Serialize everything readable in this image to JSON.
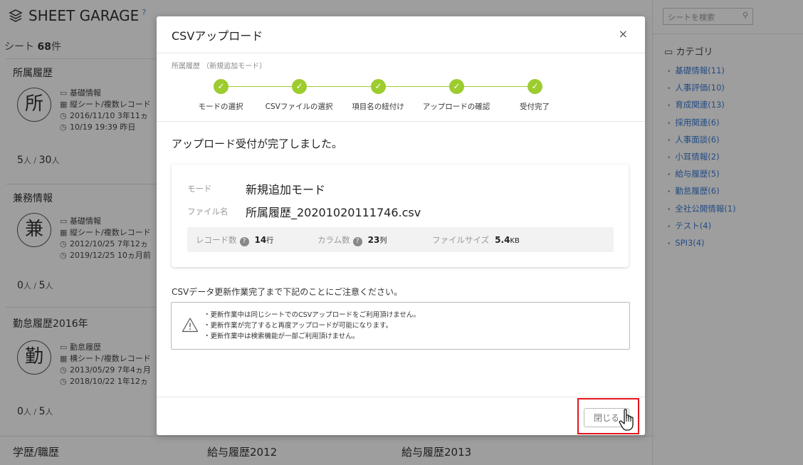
{
  "app": {
    "brand": "SHEET GARAGE",
    "help_glyph": "?",
    "sheet_count_prefix": "シート",
    "sheet_count_value": "68",
    "sheet_count_suffix": "件"
  },
  "cards": [
    {
      "title": "所属履歴",
      "kanji": "所",
      "category": "基礎情報",
      "type": "縦シート/複数レコード",
      "created": "2016/11/10 3年11ヵ",
      "updated": "10/19 19:39 昨日",
      "count_a": "5",
      "count_b": "30",
      "unit": "人"
    },
    {
      "title": "兼務情報",
      "kanji": "兼",
      "category": "基礎情報",
      "type": "縦シート/複数レコード",
      "created": "2012/10/25 7年12ヵ",
      "updated": "2019/12/25 10ヵ月前",
      "count_a": "0",
      "count_b": "5",
      "unit": "人"
    },
    {
      "title": "勤怠履歴2016年",
      "kanji": "勤",
      "category": "勤怠履歴",
      "type": "横シート/複数レコード",
      "created": "2013/05/29 7年4ヵ月",
      "updated": "2018/10/22 1年12ヵ",
      "count_a": "0",
      "count_b": "5",
      "unit": "人"
    }
  ],
  "bottom_row": [
    "学歴/職歴",
    "給与履歴2012",
    "給与履歴2013"
  ],
  "sidebar": {
    "search_placeholder": "シートを検索",
    "category_title": "カテゴリ",
    "categories": [
      "基礎情報(11)",
      "人事評価(10)",
      "育成関連(13)",
      "採用関連(6)",
      "人事面談(6)",
      "小耳情報(2)",
      "給与履歴(5)",
      "勤怠履歴(6)",
      "全社公開情報(1)",
      "テスト(4)",
      "SPI3(4)"
    ]
  },
  "modal": {
    "title": "CSVアップロード",
    "close_glyph": "×",
    "breadcrumb": "所属履歴 （新規追加モード）",
    "steps": [
      "モードの選択",
      "CSVファイルの選択",
      "項目名の紐付け",
      "アップロードの確認",
      "受付完了"
    ],
    "completion_message": "アップロード受付が完了しました。",
    "info": {
      "mode_label": "モード",
      "mode_value": "新規追加モード",
      "file_label": "ファイル名",
      "file_value": "所属履歴_20201020111746.csv",
      "records_label": "レコード数",
      "records_value": "14",
      "records_unit": "行",
      "columns_label": "カラム数",
      "columns_value": "23",
      "columns_unit": "列",
      "filesize_label": "ファイルサイズ",
      "filesize_value": "5.4",
      "filesize_unit": "KB"
    },
    "notice_title": "CSVデータ更新作業完了まで下記のことにご注意ください。",
    "notices": [
      "更新作業中は同じシートでのCSVアップロードをご利用頂けません。",
      "更新作業が完了すると再度アップロードが可能になります。",
      "更新作業中は検索機能が一部ご利用頂けません。"
    ],
    "close_button": "閉じる"
  },
  "colors": {
    "step_green": "#9ccc2e",
    "link_blue": "#3a7bd5",
    "highlight_red": "#e4141e"
  }
}
